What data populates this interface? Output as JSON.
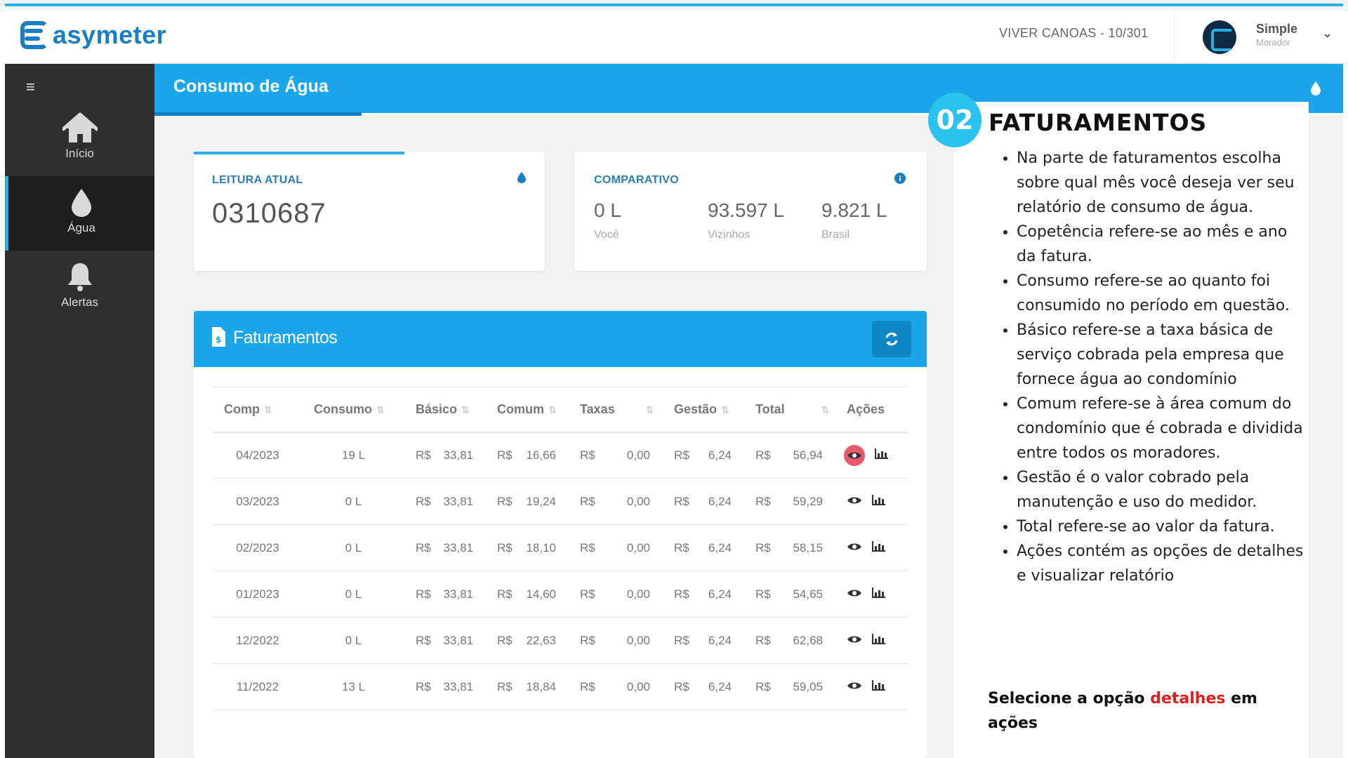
{
  "header": {
    "logo_text": "asymeter",
    "location": "VIVER CANOAS - 10/301",
    "user_name": "Simple",
    "user_role": "Morador"
  },
  "sidebar": {
    "items": [
      {
        "label": "Início",
        "icon": "home-icon"
      },
      {
        "label": "Água",
        "icon": "water-drop-icon"
      },
      {
        "label": "Alertas",
        "icon": "bell-icon"
      }
    ]
  },
  "page": {
    "title": "Consumo de Água"
  },
  "leitura": {
    "label": "LEITURA ATUAL",
    "value": "0310687"
  },
  "comparativo": {
    "label": "COMPARATIVO",
    "items": [
      {
        "value": "0 L",
        "label": "Você"
      },
      {
        "value": "93.597 L",
        "label": "Vizinhos"
      },
      {
        "value": "9.821 L",
        "label": "Brasil"
      }
    ]
  },
  "faturamentos": {
    "title": "Faturamentos",
    "columns": [
      "Comp",
      "Consumo",
      "Básico",
      "Comum",
      "Taxas",
      "Gestão",
      "Total",
      "Ações"
    ],
    "currency": "R$",
    "rows": [
      {
        "comp": "04/2023",
        "consumo": "19 L",
        "basico": "33,81",
        "comum": "16,66",
        "taxas": "0,00",
        "gestao": "6,24",
        "total": "56,94"
      },
      {
        "comp": "03/2023",
        "consumo": "0 L",
        "basico": "33,81",
        "comum": "19,24",
        "taxas": "0,00",
        "gestao": "6,24",
        "total": "59,29"
      },
      {
        "comp": "02/2023",
        "consumo": "0 L",
        "basico": "33,81",
        "comum": "18,10",
        "taxas": "0,00",
        "gestao": "6,24",
        "total": "58,15"
      },
      {
        "comp": "01/2023",
        "consumo": "0 L",
        "basico": "33,81",
        "comum": "14,60",
        "taxas": "0,00",
        "gestao": "6,24",
        "total": "54,65"
      },
      {
        "comp": "12/2022",
        "consumo": "0 L",
        "basico": "33,81",
        "comum": "22,63",
        "taxas": "0,00",
        "gestao": "6,24",
        "total": "62,68"
      },
      {
        "comp": "11/2022",
        "consumo": "13 L",
        "basico": "33,81",
        "comum": "18,84",
        "taxas": "0,00",
        "gestao": "6,24",
        "total": "59,05"
      }
    ]
  },
  "tutorial": {
    "step": "02",
    "title": "FATURAMENTOS",
    "bullets": [
      "Na parte de faturamentos escolha sobre qual mês você deseja ver seu relatório de consumo de água.",
      "Copetência refere-se ao mês e ano da fatura.",
      "Consumo refere-se ao quanto foi consumido no período em questão.",
      "Básico refere-se a taxa básica de serviço  cobrada pela empresa que fornece água ao condomínio",
      "Comum refere-se à área comum do condomínio que é cobrada e dividida entre todos os moradores.",
      "Gestão é o valor cobrado pela manutenção e uso do medidor.",
      "Total refere-se ao valor da fatura.",
      "Ações contém as opções de detalhes e visualizar relatório"
    ],
    "note_prefix": "Selecione a opção ",
    "note_highlight": "detalhes",
    "note_suffix": " em ações"
  },
  "colors": {
    "accent": "#1aa6e8",
    "sidebar": "#2f2f2f",
    "badge": "#29c3ee",
    "highlight_action": "#e85a70",
    "highlight_text": "#e01e1e"
  }
}
